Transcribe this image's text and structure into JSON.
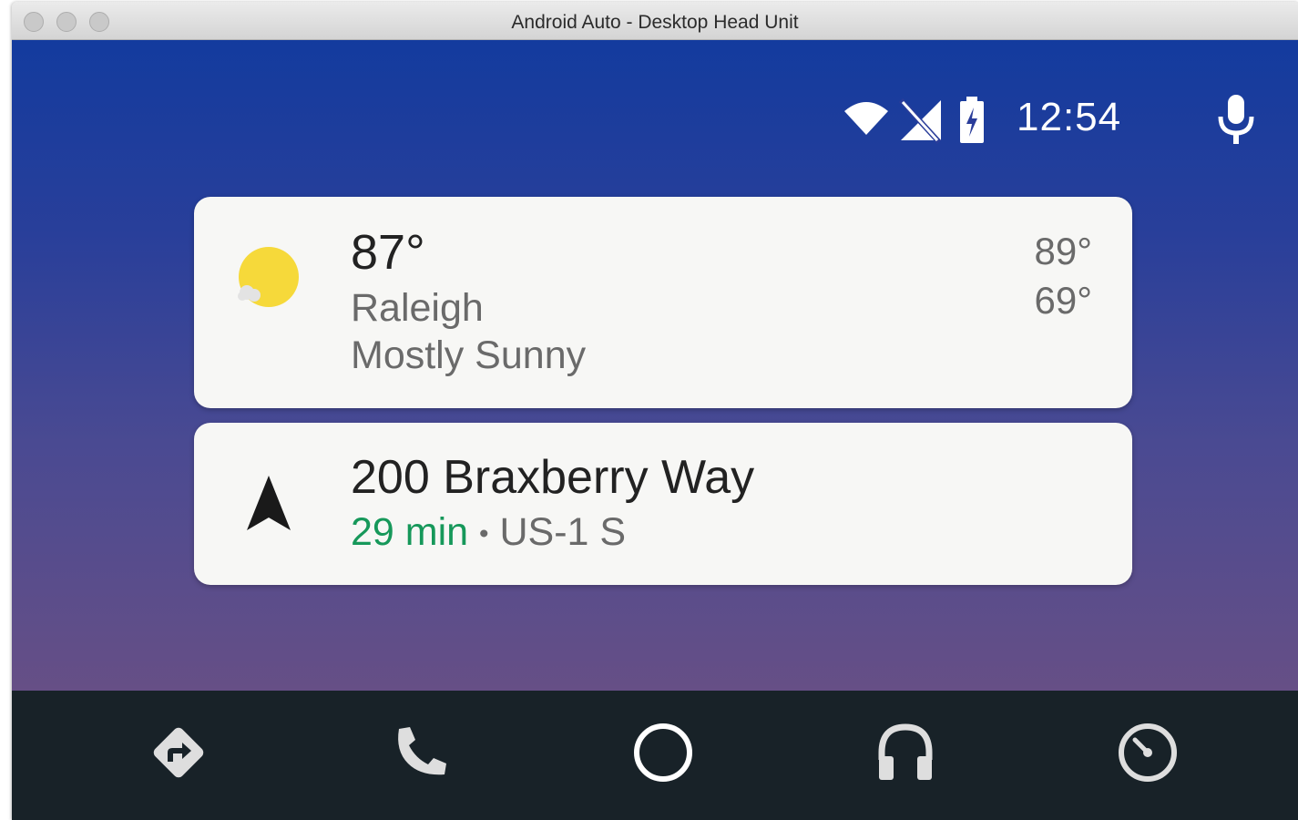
{
  "window": {
    "title": "Android Auto - Desktop Head Unit"
  },
  "status_bar": {
    "time": "12:54",
    "icons": [
      "wifi-icon",
      "no-cellular-signal-icon",
      "battery-charging-icon",
      "microphone-icon"
    ]
  },
  "weather_card": {
    "temperature": "87°",
    "city": "Raleigh",
    "condition": "Mostly Sunny",
    "high": "89°",
    "low": "69°",
    "icon": "mostly-sunny-icon"
  },
  "navigation_card": {
    "destination": "200 Braxberry Way",
    "eta": "29 min",
    "separator": "•",
    "route": "US-1 S",
    "icon": "navigation-arrow-icon"
  },
  "nav_bar": {
    "items": [
      {
        "name": "navigation",
        "icon": "directions-icon"
      },
      {
        "name": "phone",
        "icon": "phone-icon"
      },
      {
        "name": "home",
        "icon": "home-circle-icon"
      },
      {
        "name": "media",
        "icon": "headphones-icon"
      },
      {
        "name": "exit",
        "icon": "gauge-icon"
      }
    ]
  },
  "colors": {
    "eta_green": "#16985a",
    "navbar_bg": "#182228",
    "card_bg": "#f7f7f5"
  }
}
